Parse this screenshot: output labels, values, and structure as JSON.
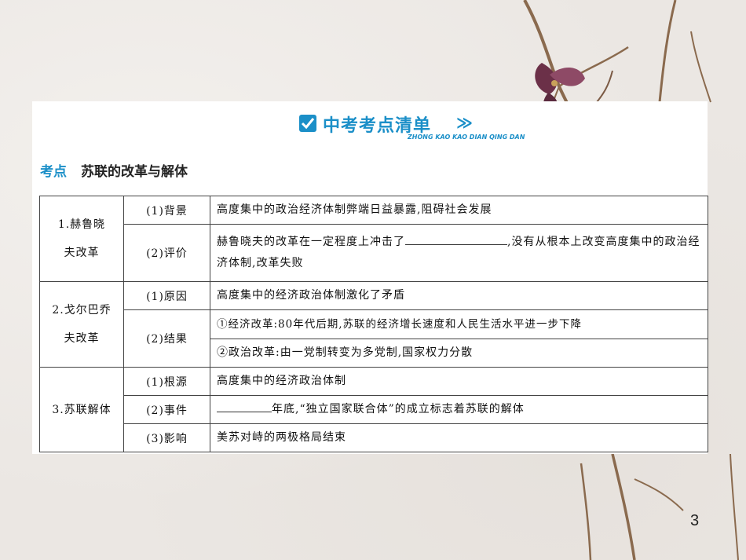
{
  "banner": {
    "title": "中考考点清单",
    "arrow": "≫",
    "pinyin": "ZHONG KAO KAO DIAN QING DAN"
  },
  "section": {
    "tag": "考点",
    "topic": "苏联的改革与解体"
  },
  "table": {
    "groups": [
      {
        "category": [
          "1.赫鲁晓",
          "夫改革"
        ],
        "rows": [
          {
            "sub": "(1)背景",
            "content": "高度集中的政治经济体制弊端日益暴露,阻碍社会发展"
          },
          {
            "sub": "(2)评价",
            "before": "赫鲁晓夫的改革在一定程度上冲击了",
            "after": ",没有从根本上改变高度集中的政治经济体制,改革失败"
          }
        ]
      },
      {
        "category": [
          "2.戈尔巴乔",
          "夫改革"
        ],
        "rows": [
          {
            "sub": "(1)原因",
            "content": "高度集中的经济政治体制激化了矛盾"
          },
          {
            "sub": "(2)结果",
            "lines": [
              "①经济改革:80年代后期,苏联的经济增长速度和人民生活水平进一步下降",
              "②政治改革:由一党制转变为多党制,国家权力分散"
            ]
          }
        ]
      },
      {
        "category": [
          "3.苏联解体"
        ],
        "rows": [
          {
            "sub": "(1)根源",
            "content": "高度集中的经济政治体制"
          },
          {
            "sub": "(2)事件",
            "after": "年底,“独立国家联合体”的成立标志着苏联的解体"
          },
          {
            "sub": "(3)影响",
            "content": "美苏对峙的两极格局结束"
          }
        ]
      }
    ]
  },
  "page_number": "3"
}
